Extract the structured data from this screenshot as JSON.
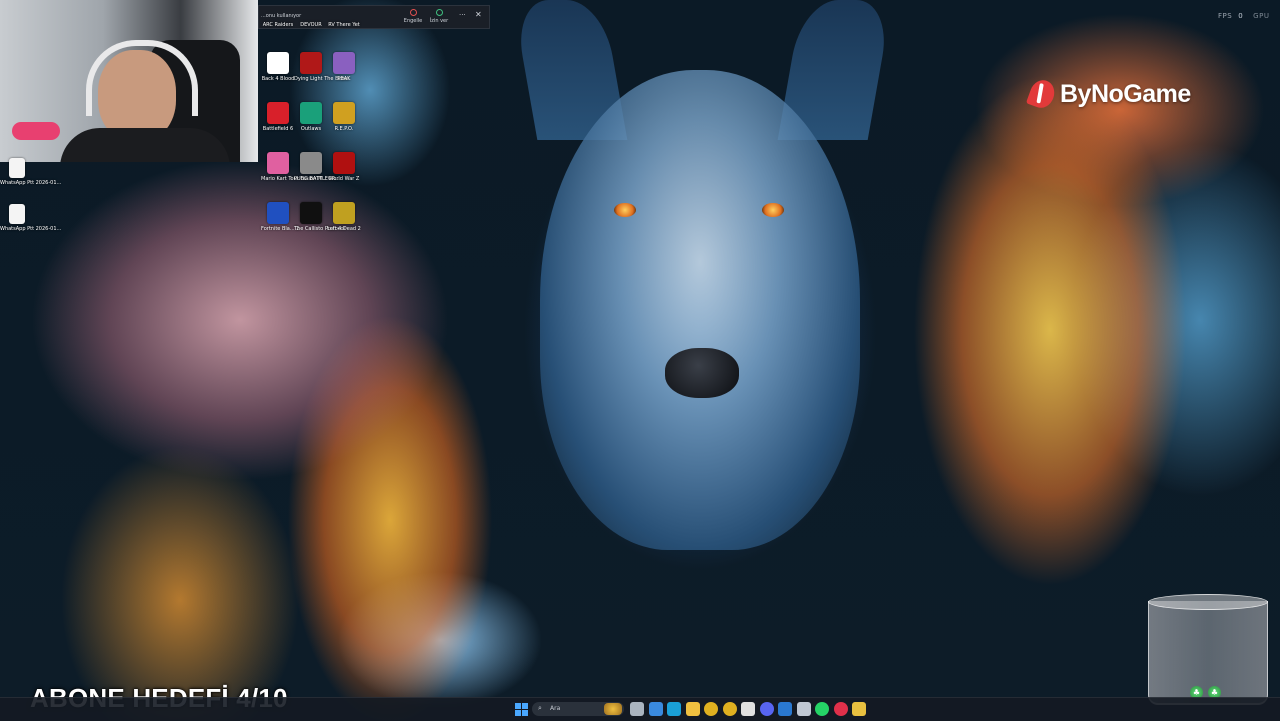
{
  "window_bar": {
    "title": "...onu kullanıyor",
    "block_label": "Engelle",
    "allow_label": "İzin ver",
    "more_label": "···",
    "close_label": "✕"
  },
  "desktop": {
    "left_icons": [
      {
        "label": "WhatsApp Ptt 2026-01...",
        "icon": "whatsapp-audio-file-icon"
      },
      {
        "label": "WhatsApp Ptt 2026-01...",
        "icon": "whatsapp-audio-file-icon"
      }
    ],
    "game_icons": [
      {
        "label": "ARC Raiders",
        "color": "#2a2f38"
      },
      {
        "label": "DEVOUR",
        "color": "#3a1010"
      },
      {
        "label": "RV There Yet",
        "color": "#3a4a6a"
      },
      {
        "label": "Back 4 Blood",
        "color": "#ffffff"
      },
      {
        "label": "Dying Light The Beast",
        "color": "#b01818"
      },
      {
        "label": "PEAK",
        "color": "#8a60c0"
      },
      {
        "label": "Battlefield 6",
        "color": "#d8202a"
      },
      {
        "label": "Outlaws",
        "color": "#1aa07a"
      },
      {
        "label": "R.E.P.O.",
        "color": "#d0a020"
      },
      {
        "label": "Mario Kart Tour Fusion M...",
        "color": "#e060a0"
      },
      {
        "label": "PUBG BATTLEGR...",
        "color": "#8a8a8a"
      },
      {
        "label": "World War Z",
        "color": "#b01010"
      },
      {
        "label": "Fortnite Bla... 2",
        "color": "#2050c0"
      },
      {
        "label": "The Callisto Protocol",
        "color": "#101010"
      },
      {
        "label": "Left 4 Dead 2",
        "color": "#c0a020"
      }
    ]
  },
  "overlay": {
    "fps_label": "FPS",
    "fps_value": "0",
    "gpu_label": "GPU",
    "logo_text": "ByNoGame",
    "goal_text": "ABONE HEDEFİ 4/10",
    "jar_coins": [
      "♣",
      "♣"
    ]
  },
  "taskbar": {
    "search_placeholder": "Ara",
    "icons": [
      "task-view-icon",
      "file-explorer-icon",
      "edge-icon",
      "folder-icon",
      "chrome-icon",
      "chrome-icon",
      "x-icon",
      "discord-icon",
      "mail-icon",
      "steam-icon",
      "whatsapp-icon",
      "opera-gx-icon",
      "file-icon"
    ],
    "colors": {
      "task-view-icon": "#aab4c0",
      "file-explorer-icon": "#3a8adf",
      "edge-icon": "#1aa0d8",
      "folder-icon": "#f0c040",
      "chrome-icon": "#e0b020",
      "x-icon": "#e0e0e0",
      "discord-icon": "#5865f2",
      "mail-icon": "#2a78d0",
      "steam-icon": "#c0c8d4",
      "whatsapp-icon": "#25d366",
      "opera-gx-icon": "#e0304a",
      "file-icon": "#e8c040"
    }
  }
}
